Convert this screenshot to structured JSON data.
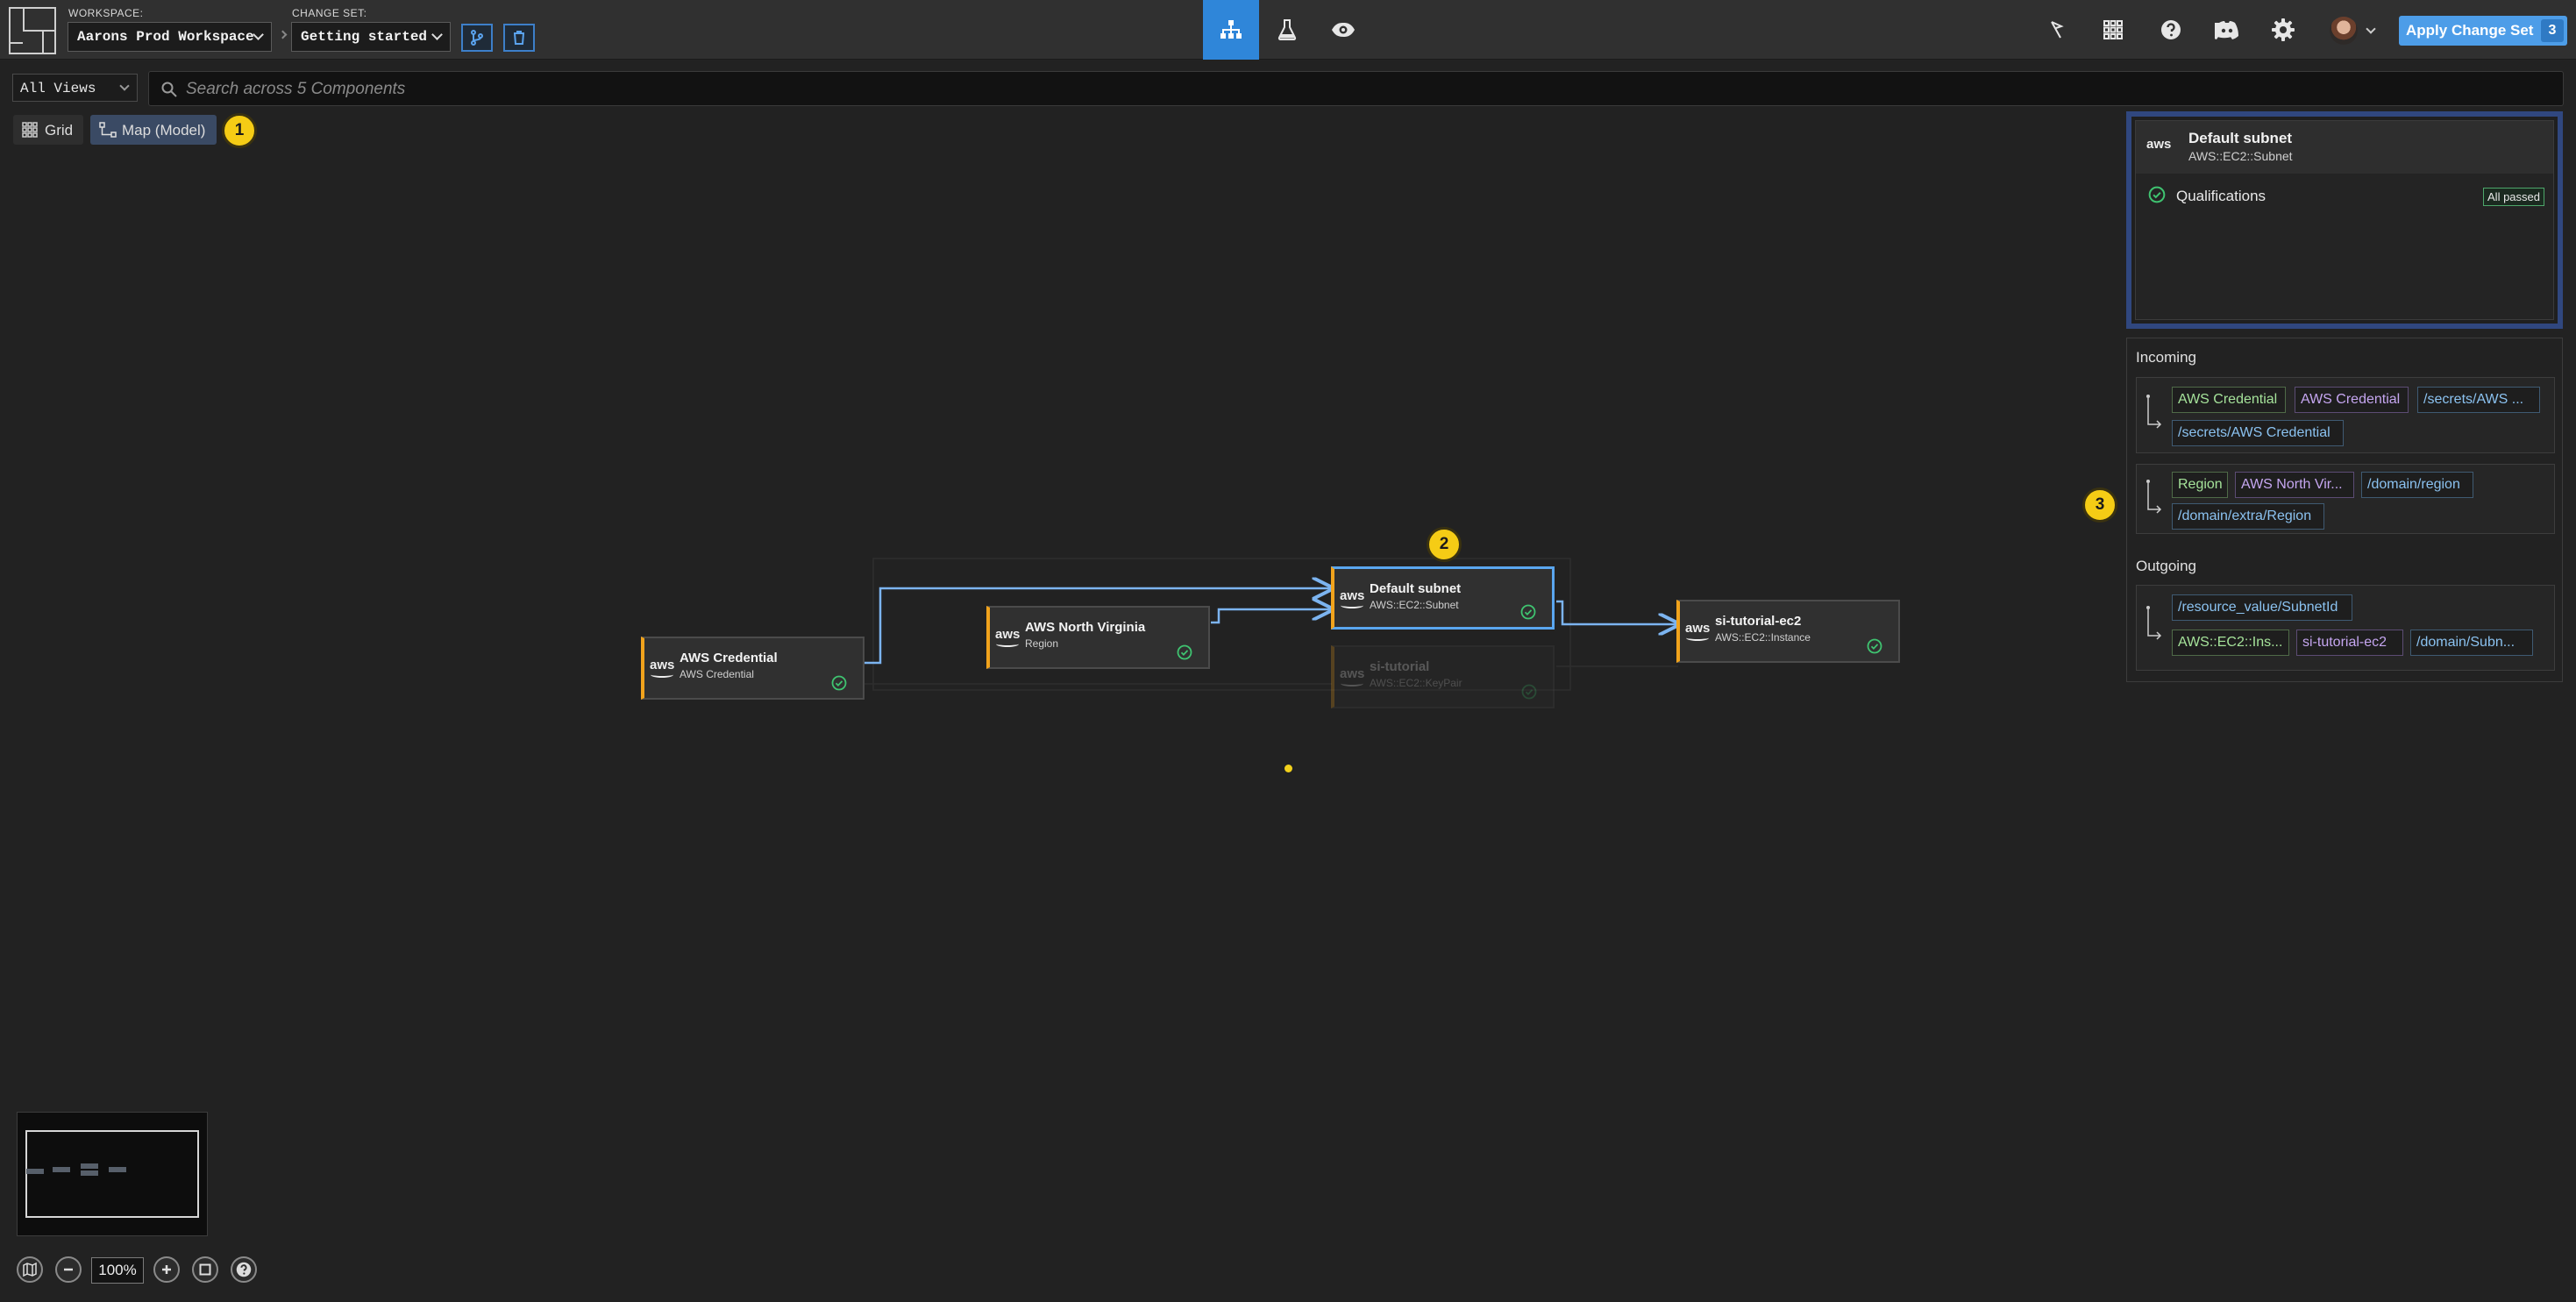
{
  "topbar": {
    "workspace_label": "WORKSPACE:",
    "workspace_value": "Aarons Prod Workspace",
    "changeset_label": "CHANGE SET:",
    "changeset_value": "Getting started",
    "apply_label": "Apply Change Set",
    "apply_count": "3",
    "accent_color": "#2f86d9"
  },
  "toolbar": {
    "views_value": "All Views",
    "search_placeholder": "Search across 5 Components",
    "grid_label": "Grid",
    "map_label": "Map (Model)"
  },
  "badges": {
    "one": "1",
    "two": "2",
    "three": "3"
  },
  "nodes": {
    "credential": {
      "title": "AWS Credential",
      "subtitle": "AWS Credential",
      "logo": "aws"
    },
    "region": {
      "title": "AWS North Virginia",
      "subtitle": "Region",
      "logo": "aws"
    },
    "subnet": {
      "title": "Default subnet",
      "subtitle": "AWS::EC2::Subnet",
      "logo": "aws"
    },
    "keypair": {
      "title": "si-tutorial",
      "subtitle": "AWS::EC2::KeyPair",
      "logo": "aws"
    },
    "ec2": {
      "title": "si-tutorial-ec2",
      "subtitle": "AWS::EC2::Instance",
      "logo": "aws"
    }
  },
  "zoom": {
    "value": "100%"
  },
  "panel": {
    "component_logo": "aws",
    "component_title": "Default subnet",
    "component_subtitle": "AWS::EC2::Subnet",
    "qualifications_label": "Qualifications",
    "qualifications_status": "All passed",
    "incoming_title": "Incoming",
    "outgoing_title": "Outgoing",
    "incoming": [
      {
        "chips": [
          "AWS Credential",
          "AWS Credential",
          "/secrets/AWS ...",
          "/secrets/AWS Credential"
        ]
      },
      {
        "chips": [
          "Region",
          "AWS North Vir...",
          "/domain/region",
          "/domain/extra/Region"
        ]
      }
    ],
    "outgoing": [
      {
        "chips": [
          "/resource_value/SubnetId",
          "AWS::EC2::Ins...",
          "si-tutorial-ec2",
          "/domain/Subn..."
        ]
      }
    ]
  },
  "icons": [
    "diagram-icon",
    "beaker-icon",
    "eye-icon",
    "cursor-icon",
    "grid-apps-icon",
    "help-icon",
    "discord-icon",
    "gear-icon",
    "search-icon",
    "map-icon",
    "check-circle-icon"
  ]
}
